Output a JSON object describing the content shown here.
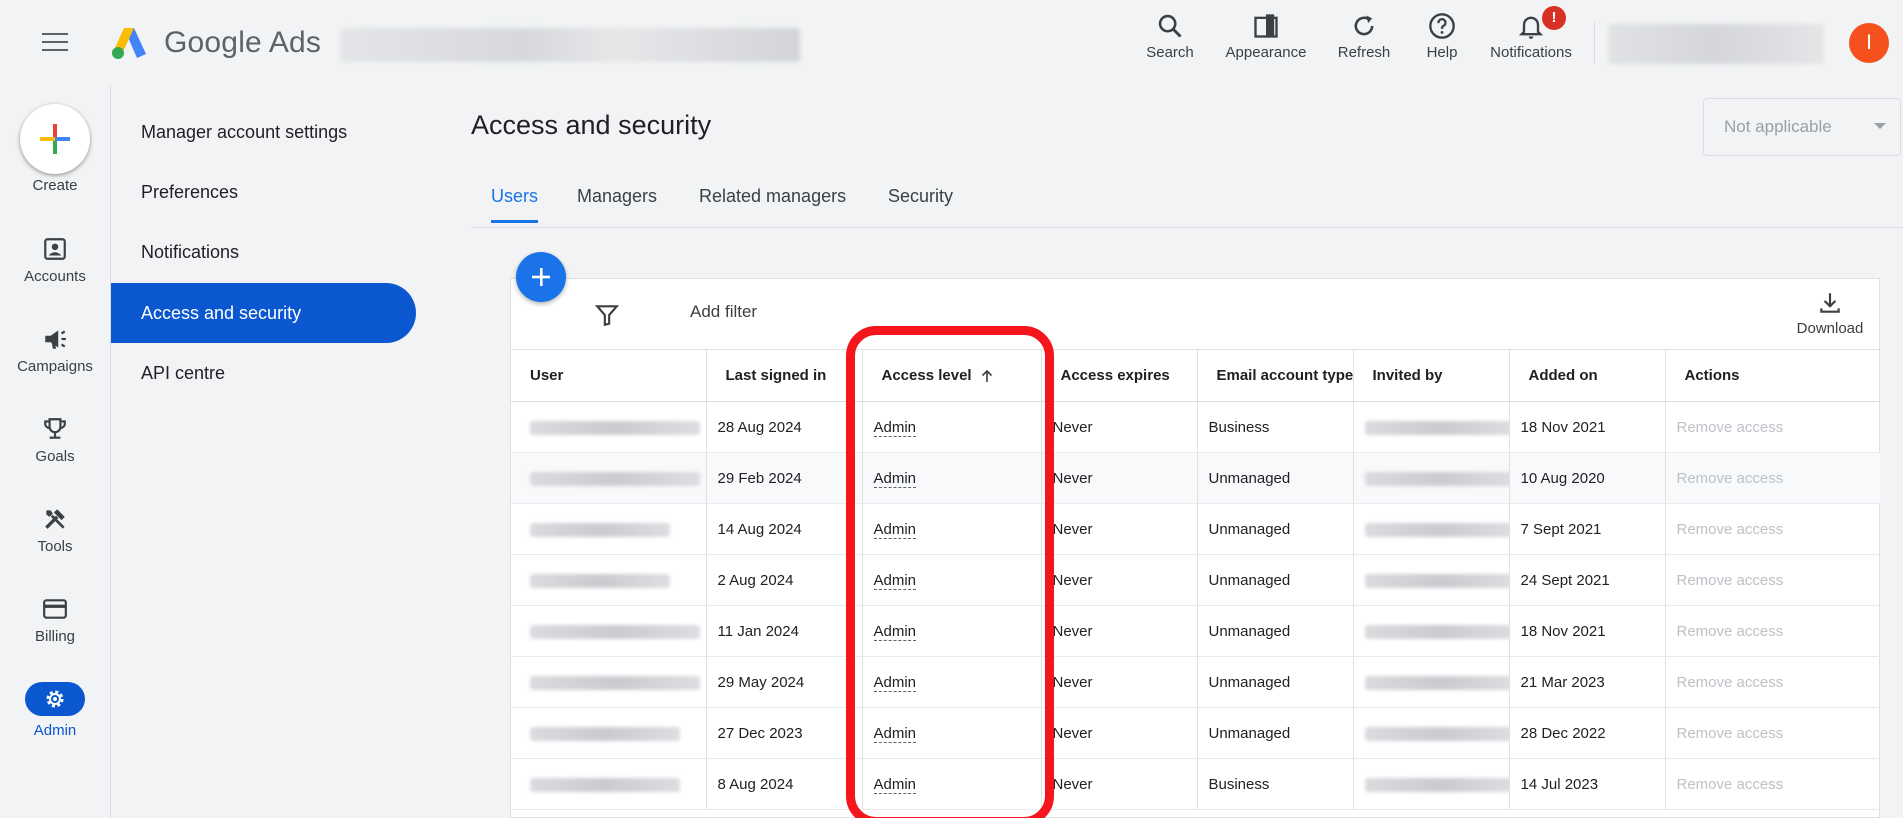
{
  "header": {
    "brand": "Google Ads",
    "actions": [
      {
        "label": "Search",
        "icon": "search-icon"
      },
      {
        "label": "Appearance",
        "icon": "appearance-icon"
      },
      {
        "label": "Refresh",
        "icon": "refresh-icon"
      },
      {
        "label": "Help",
        "icon": "help-icon"
      },
      {
        "label": "Notifications",
        "icon": "bell-icon",
        "badge": "!"
      }
    ],
    "avatar_initial": "I",
    "accent_color": "#0b57d0"
  },
  "rail": {
    "create_label": "Create",
    "items": [
      {
        "label": "Accounts",
        "icon": "accounts-icon"
      },
      {
        "label": "Campaigns",
        "icon": "megaphone-icon"
      },
      {
        "label": "Goals",
        "icon": "trophy-icon"
      },
      {
        "label": "Tools",
        "icon": "tools-icon"
      },
      {
        "label": "Billing",
        "icon": "card-icon"
      },
      {
        "label": "Admin",
        "icon": "gear-icon",
        "active": true
      }
    ]
  },
  "subnav": {
    "items": [
      {
        "label": "Manager account settings"
      },
      {
        "label": "Preferences"
      },
      {
        "label": "Notifications"
      },
      {
        "label": "Access and security",
        "active": true
      },
      {
        "label": "API centre"
      }
    ]
  },
  "main": {
    "title": "Access and security",
    "scope_select": "Not applicable",
    "tabs": [
      {
        "label": "Users",
        "active": true
      },
      {
        "label": "Managers"
      },
      {
        "label": "Related managers"
      },
      {
        "label": "Security"
      }
    ],
    "toolbar": {
      "add_filter": "Add filter",
      "download": "Download"
    },
    "table": {
      "columns": [
        "User",
        "Last signed in",
        "Access level",
        "Access expires",
        "Email account type",
        "Invited by",
        "Added on",
        "Actions"
      ],
      "rows": [
        {
          "last_signed_in": "28 Aug 2024",
          "access_level": "Admin",
          "expires": "Never",
          "email_type": "Business",
          "added_on": "18 Nov 2021",
          "action": "Remove access"
        },
        {
          "last_signed_in": "29 Feb 2024",
          "access_level": "Admin",
          "expires": "Never",
          "email_type": "Unmanaged",
          "added_on": "10 Aug 2020",
          "action": "Remove access"
        },
        {
          "last_signed_in": "14 Aug 2024",
          "access_level": "Admin",
          "expires": "Never",
          "email_type": "Unmanaged",
          "added_on": "7 Sept 2021",
          "action": "Remove access"
        },
        {
          "last_signed_in": "2 Aug 2024",
          "access_level": "Admin",
          "expires": "Never",
          "email_type": "Unmanaged",
          "added_on": "24 Sept 2021",
          "action": "Remove access"
        },
        {
          "last_signed_in": "11 Jan 2024",
          "access_level": "Admin",
          "expires": "Never",
          "email_type": "Unmanaged",
          "added_on": "18 Nov 2021",
          "action": "Remove access"
        },
        {
          "last_signed_in": "29 May 2024",
          "access_level": "Admin",
          "expires": "Never",
          "email_type": "Unmanaged",
          "added_on": "21 Mar 2023",
          "action": "Remove access"
        },
        {
          "last_signed_in": "27 Dec 2023",
          "access_level": "Admin",
          "expires": "Never",
          "email_type": "Unmanaged",
          "added_on": "28 Dec 2022",
          "action": "Remove access"
        },
        {
          "last_signed_in": "8 Aug 2024",
          "access_level": "Admin",
          "expires": "Never",
          "email_type": "Business",
          "added_on": "14 Jul 2023",
          "action": "Remove access"
        }
      ]
    },
    "highlight_color": "#f4161c"
  }
}
